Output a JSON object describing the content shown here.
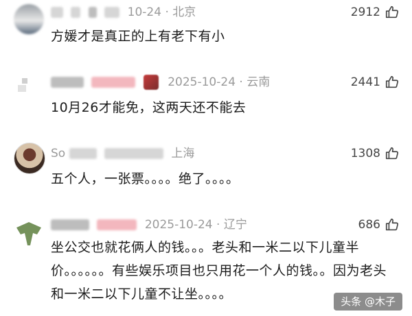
{
  "comments": [
    {
      "date": "10-24",
      "location": "北京",
      "likes": "2912",
      "text": "方媛才是真正的上有老下有小"
    },
    {
      "date": "2025-10-24",
      "location": "云南",
      "likes": "2441",
      "text": "10月26才能免，这两天还不能去"
    },
    {
      "user_fragment": "So",
      "location": "上海",
      "likes": "1308",
      "text": "五个人，一张票。。。。绝了。。。。"
    },
    {
      "date": "2025-10-24",
      "location": "辽宁",
      "likes": "686",
      "text": "坐公交也就花俩人的钱。。。老头和一米二以下儿童半价。。。。。。有些娱乐项目也只用花一个人的钱。。因为老头和一米二以下儿童不让坐。。。。"
    }
  ],
  "watermark": "头条 @木子",
  "colors": {
    "meta_text": "#9a9a9a",
    "body_text": "#1a1a1a",
    "like_count": "#444444"
  },
  "icons": {
    "like": "thumbs-up-icon"
  }
}
